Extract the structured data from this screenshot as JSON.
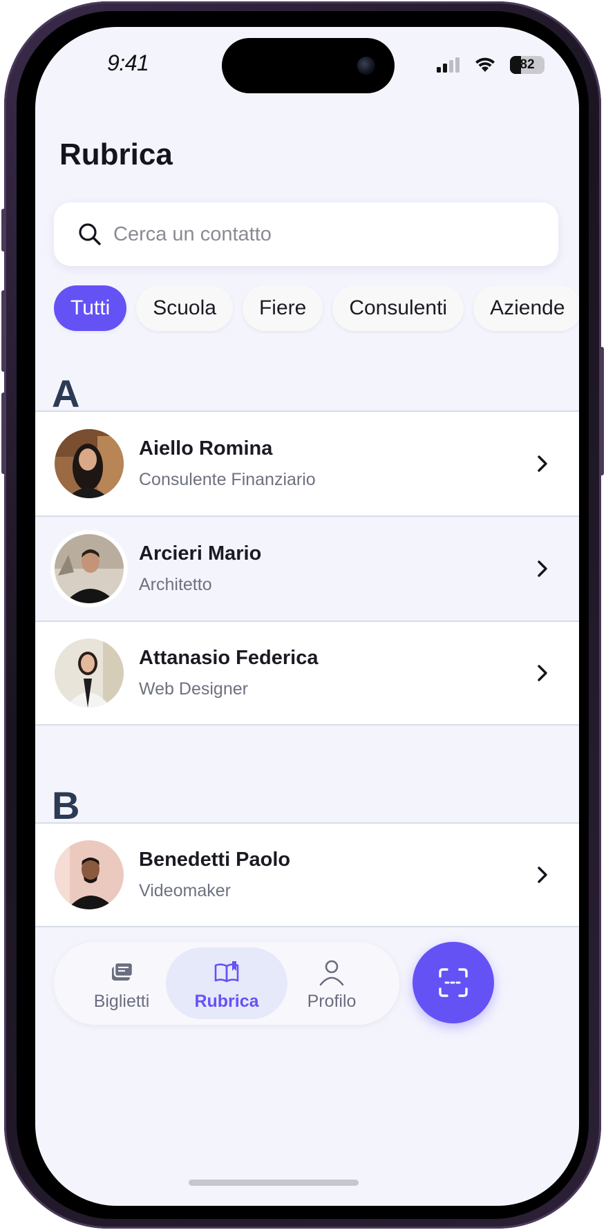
{
  "status_bar": {
    "time": "9:41",
    "battery": "82",
    "icons": [
      "signal-icon",
      "wifi-icon",
      "battery-icon"
    ]
  },
  "header": {
    "title": "Rubrica"
  },
  "search": {
    "placeholder": "Cerca un contatto",
    "value": "",
    "icon": "search-icon"
  },
  "filters": {
    "selected": "Tutti",
    "chips": [
      "Tutti",
      "Scuola",
      "Fiere",
      "Consulenti",
      "Aziende"
    ]
  },
  "sections": [
    {
      "letter": "A",
      "contacts": [
        {
          "name": "Aiello Romina",
          "role": "Consulente Finanziario"
        },
        {
          "name": "Arcieri Mario",
          "role": "Architetto"
        },
        {
          "name": "Attanasio Federica",
          "role": "Web Designer"
        }
      ]
    },
    {
      "letter": "B",
      "contacts": [
        {
          "name": "Benedetti Paolo",
          "role": "Videomaker"
        }
      ]
    }
  ],
  "tabbar": {
    "active": "Rubrica",
    "tabs": [
      {
        "label": "Biglietti",
        "icon": "cards-icon"
      },
      {
        "label": "Rubrica",
        "icon": "book-icon"
      },
      {
        "label": "Profilo",
        "icon": "person-icon"
      }
    ],
    "fab_icon": "scan-icon"
  },
  "colors": {
    "accent": "#6552f5",
    "background": "#f4f4fd",
    "text": "#1a1a24",
    "muted": "#6e7180"
  }
}
